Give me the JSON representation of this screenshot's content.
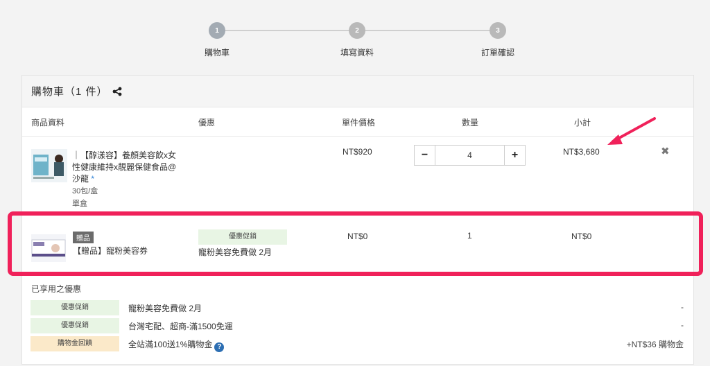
{
  "stepper": {
    "steps": [
      {
        "number": "1",
        "label": "購物車"
      },
      {
        "number": "2",
        "label": "填寫資料"
      },
      {
        "number": "3",
        "label": "訂單確認"
      }
    ]
  },
  "cart": {
    "title": "購物車（1 件）",
    "columns": {
      "product": "商品資料",
      "discount": "優惠",
      "unit_price": "單件價格",
      "quantity": "數量",
      "subtotal": "小計"
    },
    "item": {
      "name_prefix": "｜【醇漾容】養顏美容飲x女性健康維持x靚麗保健食品@沙龍",
      "star": "*",
      "spec1": "30包/盒",
      "spec2": "單盒",
      "unit_price": "NT$920",
      "quantity": "4",
      "subtotal": "NT$3,680",
      "minus": "−",
      "plus": "+",
      "remove": "✖"
    },
    "gift": {
      "badge": "贈品",
      "name": "【贈品】寵粉美容券",
      "promo_tag": "優惠促銷",
      "promo_desc": "寵粉美容免費做 2月",
      "unit_price": "NT$0",
      "quantity": "1",
      "subtotal": "NT$0"
    },
    "applied": {
      "title": "已享用之優惠",
      "rows": [
        {
          "tag": "優惠促銷",
          "desc": "寵粉美容免費做 2月",
          "value": "-"
        },
        {
          "tag": "優惠促銷",
          "desc": "台灣宅配、超商-滿1500免運",
          "value": "-"
        },
        {
          "tag": "購物金回饋",
          "desc": "全站滿100送1%購物金",
          "value": "+NT$36 購物金"
        }
      ],
      "help": "?"
    }
  },
  "colors": {
    "highlight": "#f0215a",
    "promo_green": "#e8f5e4",
    "promo_orange": "#fbe9c9",
    "help_blue": "#2d6fb3"
  },
  "icons": [
    "share-icon",
    "minus-icon",
    "plus-icon",
    "remove-icon",
    "help-icon",
    "annotation-arrow-icon"
  ]
}
